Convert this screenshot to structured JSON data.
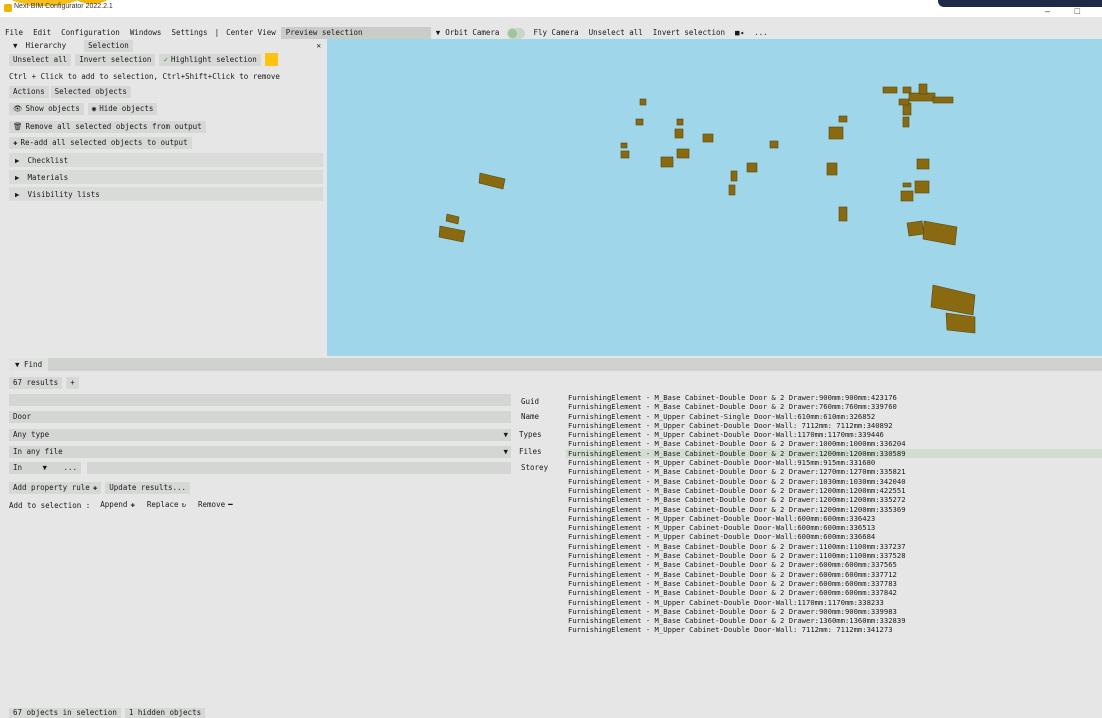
{
  "titlebar": {
    "title": "Next-BIM Configurator 2022.2.1",
    "minimize": "–",
    "maximize": "□"
  },
  "menubar": {
    "items": [
      "File",
      "Edit",
      "Configuration",
      "Windows",
      "Settings"
    ],
    "separator": "|",
    "center_view": "Center View",
    "preview_selection": "Preview selection",
    "camera_dropdown": "▼",
    "orbit_camera": "Orbit Camera",
    "fly_camera": "Fly Camera",
    "unselect_all": "Unselect all",
    "invert_selection": "Invert selection",
    "video_icon": "■◂",
    "more": "..."
  },
  "left_panel": {
    "tab_arrow": "▼",
    "tabs": [
      "Hierarchy",
      "Selection"
    ],
    "close": "✕",
    "unselect_all": "Unselect all",
    "invert_selection": "Invert selection",
    "highlight_selection": "Highlight selection",
    "highlight_color": "#ffc20e",
    "hint": "Ctrl + Click to add to selection, Ctrl+Shift+Click to remove",
    "subtabs": [
      "Actions",
      "Selected objects"
    ],
    "show_objects": "Show objects",
    "hide_objects": "Hide objects",
    "remove_all": "Remove all selected objects from output",
    "readd_all": "Re-add all selected objects to output",
    "sections": [
      "Checklist",
      "Materials",
      "Visibility lists"
    ]
  },
  "find": {
    "title": "Find",
    "results_tab": "67 results",
    "add_tab": "+",
    "guid_value": "",
    "guid_label": "Guid",
    "name_value": "Door",
    "name_label": "Name",
    "type_value": "Any type",
    "type_label": "Types",
    "file_value": "In any file",
    "file_label": "Files",
    "storey_in": "In",
    "storey_more": "...",
    "storey_label": "Storey",
    "add_property_rule": "Add property rule",
    "update_results": "Update results...",
    "add_to_selection": "Add to selection :",
    "append": "Append",
    "replace": "Replace",
    "remove": "Remove"
  },
  "results": [
    "FurnishingElement - M_Base Cabinet-Double Door & 2 Drawer:900mm:900mm:423176",
    "FurnishingElement - M_Base Cabinet-Double Door & 2 Drawer:760mm:760mm:339760",
    "FurnishingElement - M_Upper Cabinet-Single Door-Wall:610mm:610mm:326852",
    "FurnishingElement - M_Upper Cabinet-Double Door-Wall: 7112mm: 7112mm:340892",
    "FurnishingElement - M_Upper Cabinet-Double Door-Wall:1170mm:1170mm:339446",
    "FurnishingElement - M_Base Cabinet-Double Door & 2 Drawer:1000mm:1000mm:336204",
    "FurnishingElement - M_Base Cabinet-Double Door & 2 Drawer:1200mm:1200mm:330589",
    "FurnishingElement - M_Upper Cabinet-Double Door-Wall:915mm:915mm:331680",
    "FurnishingElement - M_Base Cabinet-Double Door & 2 Drawer:1270mm:1270mm:335821",
    "FurnishingElement - M_Base Cabinet-Double Door & 2 Drawer:1030mm:1030mm:342040",
    "FurnishingElement - M_Base Cabinet-Double Door & 2 Drawer:1200mm:1200mm:422551",
    "FurnishingElement - M_Base Cabinet-Double Door & 2 Drawer:1200mm:1200mm:335272",
    "FurnishingElement - M_Base Cabinet-Double Door & 2 Drawer:1200mm:1200mm:335369",
    "FurnishingElement - M_Upper Cabinet-Double Door-Wall:600mm:600mm:336423",
    "FurnishingElement - M_Upper Cabinet-Double Door-Wall:600mm:600mm:336513",
    "FurnishingElement - M_Upper Cabinet-Double Door-Wall:600mm:600mm:336684",
    "FurnishingElement - M_Base Cabinet-Double Door & 2 Drawer:1100mm:1100mm:337237",
    "FurnishingElement - M_Base Cabinet-Double Door & 2 Drawer:1100mm:1100mm:337528",
    "FurnishingElement - M_Base Cabinet-Double Door & 2 Drawer:600mm:600mm:337565",
    "FurnishingElement - M_Base Cabinet-Double Door & 2 Drawer:600mm:600mm:337712",
    "FurnishingElement - M_Base Cabinet-Double Door & 2 Drawer:600mm:600mm:337783",
    "FurnishingElement - M_Base Cabinet-Double Door & 2 Drawer:600mm:600mm:337842",
    "FurnishingElement - M_Upper Cabinet-Double Door-Wall:1170mm:1170mm:338233",
    "FurnishingElement - M_Base Cabinet-Double Door & 2 Drawer:900mm:900mm:339983",
    "FurnishingElement - M_Base Cabinet-Double Door & 2 Drawer:1360mm:1360mm:332839",
    "FurnishingElement - M_Upper Cabinet-Double Door-Wall: 7112mm: 7112mm:341273"
  ],
  "highlighted_result_index": 6,
  "status": {
    "selection": "67 objects in selection",
    "hidden": "1 hidden objects"
  },
  "colors": {
    "viewport_bg": "#9fd6ea",
    "object_color": "#8a6a10",
    "highlight": "#ffc20e"
  }
}
